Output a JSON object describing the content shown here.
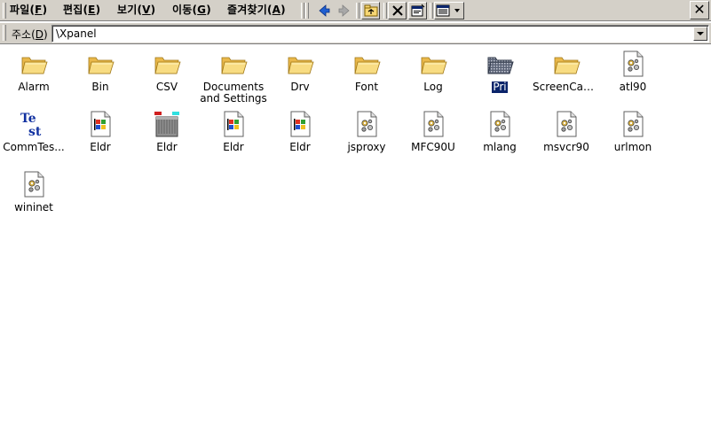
{
  "menu": {
    "items": [
      {
        "label": "파일(",
        "acc": "F",
        "end": ")"
      },
      {
        "label": "편집(",
        "acc": "E",
        "end": ")"
      },
      {
        "label": "보기(",
        "acc": "V",
        "end": ")"
      },
      {
        "label": "이동(",
        "acc": "G",
        "end": ")"
      },
      {
        "label": "즐겨찾기(",
        "acc": "A",
        "end": ")"
      }
    ],
    "close_label": "✕"
  },
  "toolbar": {
    "buttons": [
      "back-arrow-icon",
      "forward-arrow-icon",
      "up-folder-icon",
      "delete-icon",
      "properties-icon",
      "views-icon"
    ]
  },
  "address": {
    "label_pre": "주소(",
    "label_acc": "D",
    "label_end": ")",
    "value": "\\Xpanel"
  },
  "files": [
    {
      "name": "Alarm",
      "icon": "folder"
    },
    {
      "name": "Bin",
      "icon": "folder"
    },
    {
      "name": "CSV",
      "icon": "folder"
    },
    {
      "name": "Documents and Settings",
      "icon": "folder"
    },
    {
      "name": "Drv",
      "icon": "folder"
    },
    {
      "name": "Font",
      "icon": "folder"
    },
    {
      "name": "Log",
      "icon": "folder"
    },
    {
      "name": "Pri",
      "icon": "system-folder"
    },
    {
      "name": "ScreenCap...",
      "icon": "folder"
    },
    {
      "name": "atl90",
      "icon": "dll"
    },
    {
      "name": "CommTes...",
      "icon": "test-app"
    },
    {
      "name": "Eldr",
      "icon": "windows-app"
    },
    {
      "name": "Eldr",
      "icon": "network-app"
    },
    {
      "name": "Eldr",
      "icon": "windows-app"
    },
    {
      "name": "Eldr",
      "icon": "windows-app"
    },
    {
      "name": "jsproxy",
      "icon": "dll"
    },
    {
      "name": "MFC90U",
      "icon": "dll"
    },
    {
      "name": "mlang",
      "icon": "dll"
    },
    {
      "name": "msvcr90",
      "icon": "dll"
    },
    {
      "name": "urlmon",
      "icon": "dll"
    },
    {
      "name": "wininet",
      "icon": "dll"
    }
  ],
  "colors": {
    "chrome": "#d4d0c8",
    "folder": "#f7d774",
    "selection": "#0a246a",
    "toolbar_arrow": "#1f5fd1"
  }
}
